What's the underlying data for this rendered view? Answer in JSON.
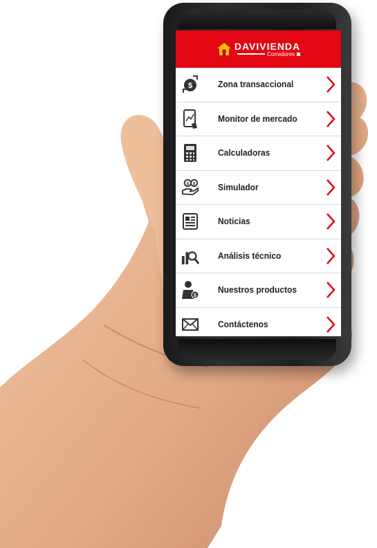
{
  "app": {
    "brand": "DAVIVIENDA",
    "subbrand": "Corredores"
  },
  "colors": {
    "header": "#e30613",
    "chevron": "#e30613",
    "icon": "#333333",
    "skin": "#e8b48e"
  },
  "menu": [
    {
      "label": "Zona transaccional",
      "icon": "money-exchange-icon"
    },
    {
      "label": "Monitor de mercado",
      "icon": "tablet-chart-icon"
    },
    {
      "label": "Calculadoras",
      "icon": "calculator-icon"
    },
    {
      "label": "Simulador",
      "icon": "hand-coins-icon"
    },
    {
      "label": "Noticias",
      "icon": "newspaper-icon"
    },
    {
      "label": "Análisis técnico",
      "icon": "chart-magnifier-icon"
    },
    {
      "label": "Nuestros productos",
      "icon": "person-money-icon"
    },
    {
      "label": "Contáctenos",
      "icon": "envelope-icon"
    }
  ]
}
